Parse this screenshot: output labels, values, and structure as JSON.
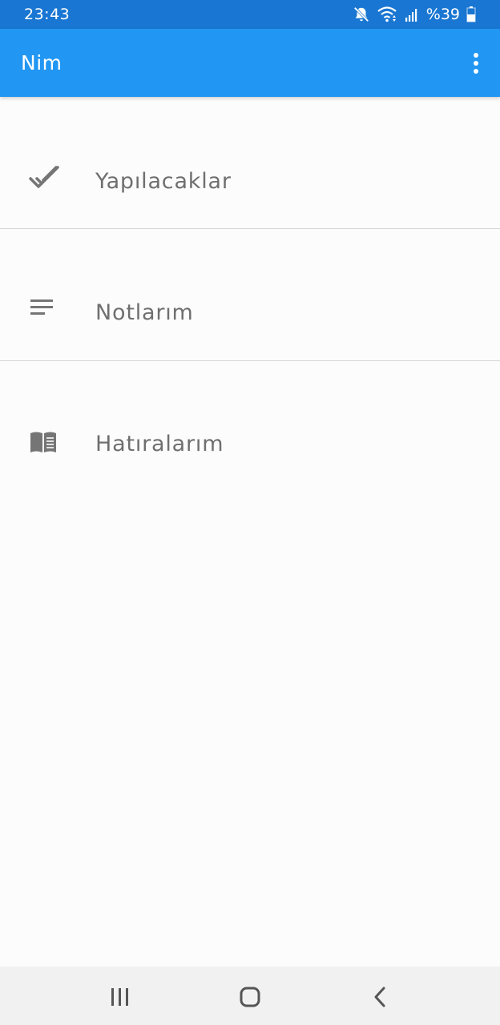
{
  "status_bar": {
    "time": "23:43",
    "battery": "%39"
  },
  "app_bar": {
    "title": "Nim",
    "overflow_icon": "more-vert-icon"
  },
  "menu": {
    "items": [
      {
        "label": "Yapılacaklar",
        "icon": "check-icon"
      },
      {
        "label": "Notlarım",
        "icon": "notes-icon"
      },
      {
        "label": "Hatıralarım",
        "icon": "book-icon"
      }
    ]
  },
  "colors": {
    "status_bar": "#1976d2",
    "app_bar": "#2196f3",
    "label_text": "#6f6f6f",
    "icon": "#757575",
    "background": "#fcfcfc"
  }
}
